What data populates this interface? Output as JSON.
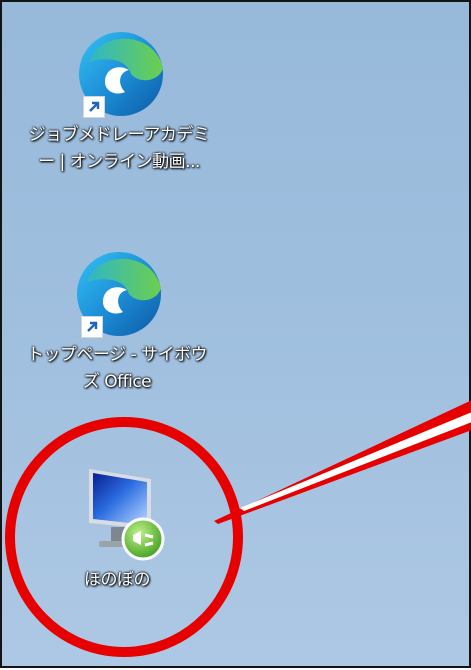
{
  "desktop": {
    "icons": [
      {
        "label_line1": "ジョブメドレーアカデミ",
        "label_line2": "ー | オンライン動画..."
      },
      {
        "label_line1": "トップページ - サイボウ",
        "label_line2": "ズ Office"
      },
      {
        "label_line1": "ほのぼの"
      }
    ]
  },
  "colors": {
    "desktop_bg": "#a1c0df",
    "annotation_red": "#e60000",
    "edge_teal": "#1fb8c8",
    "edge_blue": "#0c59a4",
    "edge_green": "#5ec64a"
  },
  "icons": [
    "edge-browser-icon",
    "shortcut-arrow-icon",
    "remote-desktop-icon"
  ]
}
